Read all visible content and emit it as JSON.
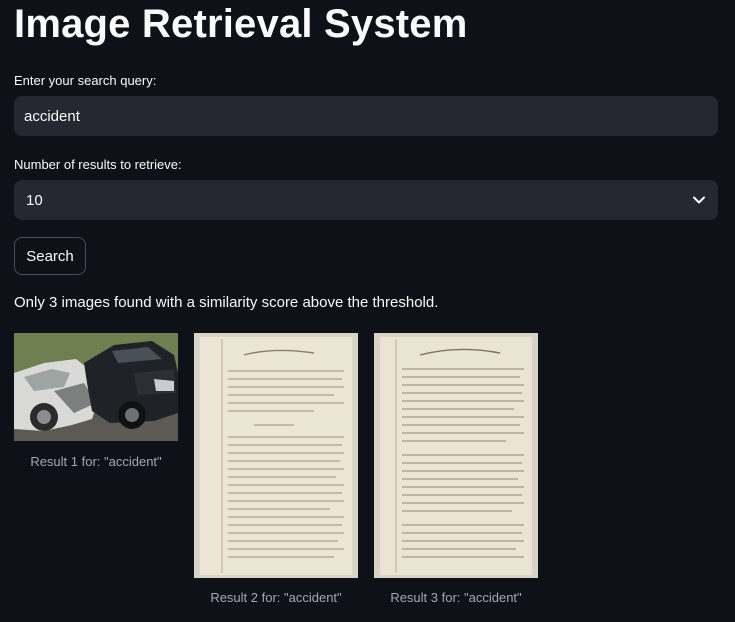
{
  "page": {
    "title": "Image Retrieval System"
  },
  "query": {
    "label": "Enter your search query:",
    "value": "accident"
  },
  "num_results": {
    "label": "Number of results to retrieve:",
    "selected": "10"
  },
  "search_button": {
    "label": "Search"
  },
  "status_message": "Only 3 images found with a similarity score above the threshold.",
  "results": [
    {
      "caption": "Result 1 for: \"accident\""
    },
    {
      "caption": "Result 2 for: \"accident\""
    },
    {
      "caption": "Result 3 for: \"accident\""
    }
  ],
  "colors": {
    "background": "#0e1117",
    "input_bg": "#262730",
    "text": "#fafafa",
    "caption": "#a3a8b4"
  },
  "icons": {
    "select_chevron": "chevron-down-icon"
  }
}
